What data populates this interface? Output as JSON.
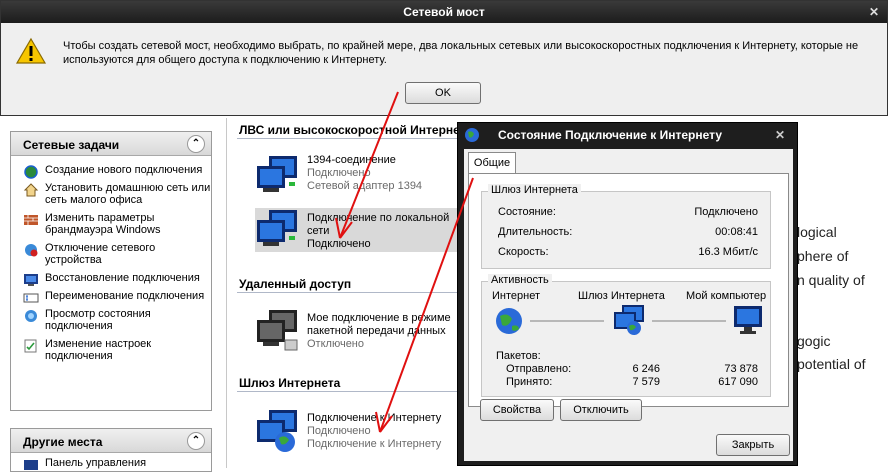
{
  "background_text": [
    "logical",
    "phere of",
    "n quality of",
    "gogic",
    "potential of"
  ],
  "message_box": {
    "title": "Сетевой мост",
    "close_glyph": "✕",
    "text": "Чтобы создать сетевой мост, необходимо выбрать, по крайней мере, два локальных сетевых или высокоскоростных подключения к Интернету, которые не используются для общего доступа к подключению к Интернету.",
    "ok_label": "OK"
  },
  "network_tasks": {
    "title": "Сетевые задачи",
    "collapse_glyph": "«",
    "items": [
      {
        "label": "Создание нового подключения",
        "icon": "new-connection-icon"
      },
      {
        "label": "Установить домашнюю сеть или сеть малого офиса",
        "icon": "home-network-icon"
      },
      {
        "label": "Изменить параметры брандмауэра Windows",
        "icon": "firewall-icon"
      },
      {
        "label": "Отключение сетевого устройства",
        "icon": "disable-device-icon"
      },
      {
        "label": "Восстановление подключения",
        "icon": "repair-icon"
      },
      {
        "label": "Переименование подключения",
        "icon": "rename-icon"
      },
      {
        "label": "Просмотр состояния подключения",
        "icon": "view-status-icon"
      },
      {
        "label": "Изменение настроек подключения",
        "icon": "change-settings-icon"
      }
    ]
  },
  "other_places": {
    "title": "Другие места",
    "collapse_glyph": "«",
    "first_item": "Панель управления"
  },
  "connections": {
    "group_lan": "ЛВС или высокоскоростной Интернет",
    "group_remote": "Удаленный доступ",
    "group_gateway": "Шлюз Интернета",
    "items": [
      {
        "line1": "1394-соединение",
        "line2": "Подключено",
        "line3": "Сетевой адаптер 1394"
      },
      {
        "line1": "Подключение по локальной",
        "line2": "сети",
        "line3": "Подключено"
      },
      {
        "line1": "Мое подключение в режиме",
        "line2": "пакетной передачи данных",
        "line3": "Отключено"
      },
      {
        "line1": "Подключение к Интернету",
        "line2": "Подключено",
        "line3": "Подключение к Интернету"
      }
    ]
  },
  "status_dialog": {
    "title": "Состояние Подключение к Интернету",
    "close_glyph": "✕",
    "tab_general": "Общие",
    "gateway_legend": "Шлюз Интернета",
    "status_label": "Состояние:",
    "status_value": "Подключено",
    "duration_label": "Длительность:",
    "duration_value": "00:08:41",
    "speed_label": "Скорость:",
    "speed_value": "16.3 Мбит/с",
    "activity_legend": "Активность",
    "node_internet": "Интернет",
    "node_gateway": "Шлюз Интернета",
    "node_computer": "Мой компьютер",
    "packets_label": "Пакетов:",
    "sent_label": "Отправлено:",
    "sent_gateway": "6 246",
    "sent_computer": "73 878",
    "received_label": "Принято:",
    "received_gateway": "7 579",
    "received_computer": "617 090",
    "properties_button": "Свойства",
    "disconnect_button": "Отключить",
    "close_button": "Закрыть"
  },
  "colors": {
    "arrow": "#e01010",
    "title_dark": "#1e1e1e",
    "accent_blue": "#1a5fcf"
  }
}
